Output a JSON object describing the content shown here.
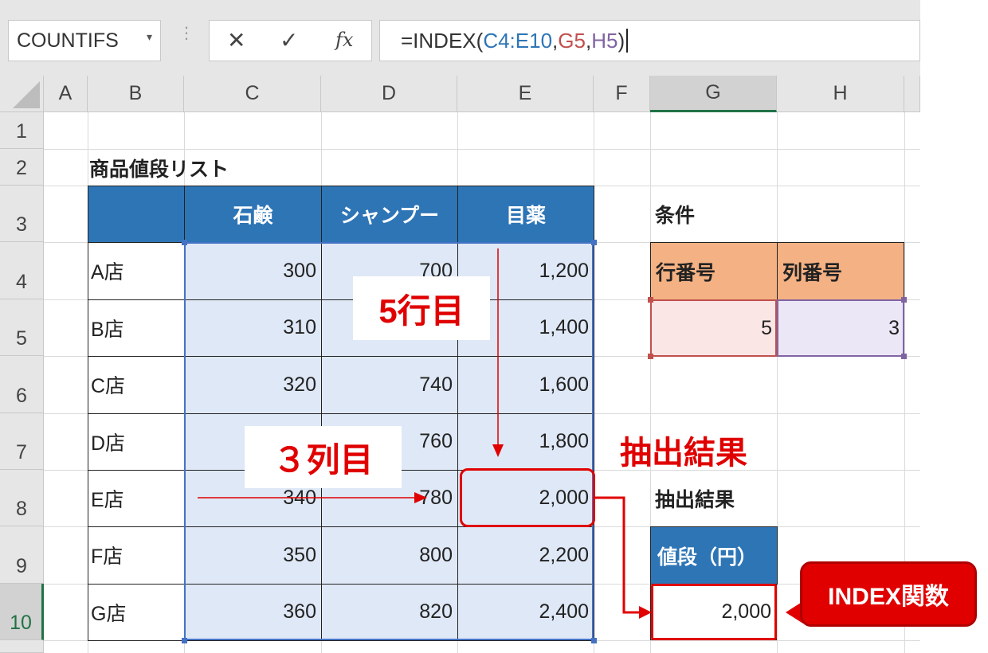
{
  "formula_bar": {
    "name_box": "COUNTIFS",
    "name_box_dropdown": "▾",
    "cancel_icon": "✕",
    "enter_icon": "✓",
    "fx_label": "fx",
    "formula_prefix": "=INDEX(",
    "formula_arg1": "C4:E10",
    "formula_comma1": ",",
    "formula_arg2": "G5",
    "formula_comma2": ",",
    "formula_arg3": "H5",
    "formula_suffix": ")"
  },
  "columns": [
    "A",
    "B",
    "C",
    "D",
    "E",
    "F",
    "G",
    "H"
  ],
  "rows": [
    "1",
    "2",
    "3",
    "4",
    "5",
    "6",
    "7",
    "8",
    "9",
    "10"
  ],
  "sheet": {
    "list_title": "商品値段リスト",
    "table_headers": [
      "石鹸",
      "シャンプー",
      "目薬"
    ],
    "table_rows": [
      {
        "store": "A店",
        "values": [
          "300",
          "700",
          "1,200"
        ]
      },
      {
        "store": "B店",
        "values": [
          "310",
          "",
          "1,400"
        ]
      },
      {
        "store": "C店",
        "values": [
          "320",
          "740",
          "1,600"
        ]
      },
      {
        "store": "D店",
        "values": [
          "",
          "760",
          "1,800"
        ]
      },
      {
        "store": "E店",
        "values": [
          "340",
          "780",
          "2,000"
        ]
      },
      {
        "store": "F店",
        "values": [
          "350",
          "800",
          "2,200"
        ]
      },
      {
        "store": "G店",
        "values": [
          "360",
          "820",
          "2,400"
        ]
      }
    ],
    "condition_label": "条件",
    "row_number_header": "行番号",
    "col_number_header": "列番号",
    "row_number_value": "5",
    "col_number_value": "3",
    "result_label": "抽出結果",
    "price_header": "値段（円）",
    "result_value": "2,000"
  },
  "annotations": {
    "row_label": "5行目",
    "col_label": "３列目",
    "result_title": "抽出結果",
    "callout": "INDEX関数"
  },
  "colors": {
    "header_blue": "#2e75b6",
    "orange_header": "#f4b183",
    "highlight_red": "#e00000",
    "excel_green": "#217346",
    "formula_blue": "#2e75b6",
    "formula_red": "#c0504d",
    "formula_purple": "#8064a2"
  }
}
